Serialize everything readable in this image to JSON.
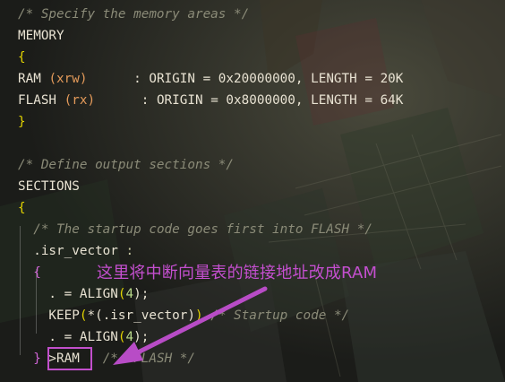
{
  "editor": {
    "lines": [
      {
        "parts": [
          {
            "t": "/* Specify the memory areas */",
            "c": "comment"
          }
        ]
      },
      {
        "parts": [
          {
            "t": "MEMORY",
            "c": ""
          }
        ]
      },
      {
        "parts": [
          {
            "t": "{",
            "c": "brace-y"
          }
        ]
      },
      {
        "parts": [
          {
            "t": "RAM ",
            "c": ""
          },
          {
            "t": "(xrw)",
            "c": "arg"
          },
          {
            "t": "      : ORIGIN = 0x20000000, LENGTH = 20K",
            "c": ""
          }
        ]
      },
      {
        "parts": [
          {
            "t": "FLASH ",
            "c": ""
          },
          {
            "t": "(rx)",
            "c": "arg"
          },
          {
            "t": "      : ORIGIN = 0x8000000, LENGTH = 64K",
            "c": ""
          }
        ]
      },
      {
        "parts": [
          {
            "t": "}",
            "c": "brace-y"
          }
        ]
      },
      {
        "parts": []
      },
      {
        "parts": [
          {
            "t": "/* Define output sections */",
            "c": "comment"
          }
        ]
      },
      {
        "parts": [
          {
            "t": "SECTIONS",
            "c": ""
          }
        ]
      },
      {
        "parts": [
          {
            "t": "{",
            "c": "brace-y"
          }
        ]
      },
      {
        "parts": [
          {
            "t": "  ",
            "c": ""
          },
          {
            "t": "/* The startup code goes first into FLASH */",
            "c": "comment"
          }
        ]
      },
      {
        "parts": [
          {
            "t": "  .isr_vector ",
            "c": ""
          },
          {
            "t": ":",
            "c": "sym"
          }
        ]
      },
      {
        "parts": [
          {
            "t": "  ",
            "c": ""
          },
          {
            "t": "{",
            "c": "brace-p"
          }
        ]
      },
      {
        "parts": [
          {
            "t": "    . = ALIGN",
            "c": ""
          },
          {
            "t": "(",
            "c": "brace-y"
          },
          {
            "t": "4",
            "c": "num"
          },
          {
            "t": ");",
            "c": ""
          }
        ]
      },
      {
        "parts": [
          {
            "t": "    KEEP",
            "c": ""
          },
          {
            "t": "(",
            "c": "brace-y"
          },
          {
            "t": "*(.isr_vector)",
            "c": ""
          },
          {
            "t": ")",
            "c": "brace-y"
          },
          {
            "t": " ",
            "c": ""
          },
          {
            "t": "/* Startup code */",
            "c": "comment"
          }
        ]
      },
      {
        "parts": [
          {
            "t": "    . = ALIGN",
            "c": ""
          },
          {
            "t": "(",
            "c": "brace-y"
          },
          {
            "t": "4",
            "c": "num"
          },
          {
            "t": ");",
            "c": ""
          }
        ]
      },
      {
        "parts": [
          {
            "t": "  ",
            "c": ""
          },
          {
            "t": "}",
            "c": "brace-p"
          },
          {
            "t": " >RAM   ",
            "c": ""
          },
          {
            "t": "/* >FLASH */",
            "c": "comment"
          }
        ]
      }
    ]
  },
  "annotation": {
    "text": "这里将中断向量表的链接地址改成RAM"
  }
}
